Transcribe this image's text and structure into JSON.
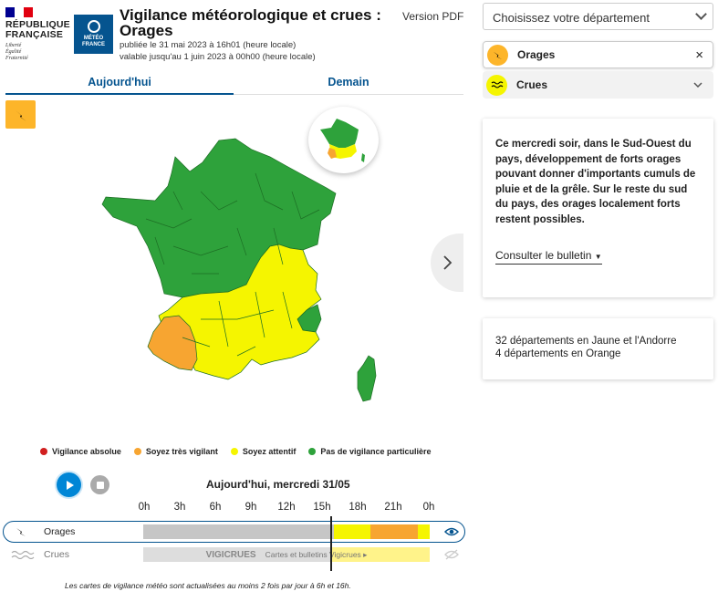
{
  "header": {
    "republic_name": "République Française",
    "republic_motto": [
      "Liberté",
      "Égalité",
      "Fraternité"
    ],
    "meteo_logo_text": [
      "MÉTÉO",
      "FRANCE"
    ],
    "title_line1": "Vigilance météorologique et crues :",
    "title_line2": "Orages",
    "published": "publiée le 31 mai 2023 à 16h01 (heure locale)",
    "valid_until": "valable jusqu'au 1 juin 2023 à 00h00 (heure locale)",
    "pdf_link": "Version PDF"
  },
  "tabs": [
    {
      "label": "Aujourd'hui",
      "active": true
    },
    {
      "label": "Demain",
      "active": false
    }
  ],
  "colors": {
    "brand_blue": "#05548f",
    "green": "#2ea23b",
    "yellow": "#f5f500",
    "orange": "#f7a531",
    "red": "#d11f1f",
    "grey": "#c6c6c6",
    "accent": "#0086d6"
  },
  "icons": {
    "phenomenon_badge": "lightning-icon",
    "inset_map": "france-mini-map",
    "next": "chevron-right-icon"
  },
  "legend": [
    {
      "label": "Vigilance absolue",
      "color": "#d11f1f"
    },
    {
      "label": "Soyez très vigilant",
      "color": "#f7a531"
    },
    {
      "label": "Soyez attentif",
      "color": "#f5f500"
    },
    {
      "label": "Pas de vigilance particulière",
      "color": "#2ea23b"
    }
  ],
  "timeline": {
    "day_label": "Aujourd'hui, mercredi 31/05",
    "hours": [
      "0h",
      "3h",
      "6h",
      "9h",
      "12h",
      "15h",
      "18h",
      "21h",
      "0h"
    ],
    "current_hour": 16,
    "rows": [
      {
        "label": "Orages",
        "icon": "lightning-icon",
        "segments": [
          {
            "from": 0,
            "to": 16,
            "level": "grey"
          },
          {
            "from": 16,
            "to": 19,
            "level": "yellow"
          },
          {
            "from": 19,
            "to": 23,
            "level": "orange"
          },
          {
            "from": 23,
            "to": 24,
            "level": "yellow"
          }
        ]
      },
      {
        "label": "Crues",
        "icon": "waves-icon",
        "vigicrues_logo": "VIGICRUES",
        "link_text": "Cartes et bulletins Vigicrues ▸"
      }
    ],
    "footnote": "Les cartes de vigilance météo sont actualisées au moins 2 fois par jour à 6h et 16h."
  },
  "sidebar": {
    "select_placeholder": "Choisissez votre département",
    "chips": [
      {
        "label": "Orages",
        "icon": "lightning-icon",
        "action": "×"
      },
      {
        "label": "Crues",
        "icon": "waves-icon",
        "action": "chevron-down"
      }
    ],
    "bulletin_text": "Ce mercredi soir, dans le Sud-Ouest du pays, développement de forts orages pouvant donner d'importants cumuls de pluie et de la grêle. Sur le reste du sud du pays, des orages localement forts restent possibles.",
    "bulletin_link": "Consulter le bulletin",
    "counts": [
      "32 départements en Jaune et l'Andorre",
      "4 départements en Orange"
    ]
  }
}
